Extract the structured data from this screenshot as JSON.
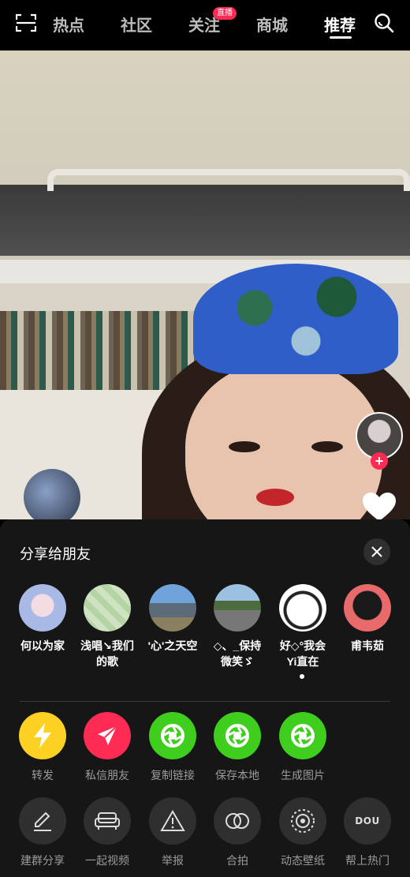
{
  "top_nav": {
    "tabs": [
      {
        "label": "热点"
      },
      {
        "label": "社区"
      },
      {
        "label": "关注"
      },
      {
        "label": "商城"
      },
      {
        "label": "推荐"
      }
    ],
    "live_badge": "直播",
    "active_tab": "推荐"
  },
  "share_sheet": {
    "title": "分享给朋友",
    "friends": [
      {
        "name": "何以为家"
      },
      {
        "name": "浅唱↘我们的歌"
      },
      {
        "name": "'心'之天空"
      },
      {
        "name": "◇、_保持微笑ゞ"
      },
      {
        "name": "好◇°我会Yi直在"
      },
      {
        "name": "甫韦茹"
      }
    ],
    "primary_actions": [
      {
        "label": "转发",
        "icon": "lightning-icon",
        "color": "#fdd124"
      },
      {
        "label": "私信朋友",
        "icon": "send-icon",
        "color": "#fe2c55"
      },
      {
        "label": "复制链接",
        "icon": "wechat-shutter-icon",
        "color": "#3fcd1e"
      },
      {
        "label": "保存本地",
        "icon": "wechat-shutter-icon",
        "color": "#3fcd1e"
      },
      {
        "label": "生成图片",
        "icon": "wechat-shutter-icon",
        "color": "#3fcd1e"
      }
    ],
    "secondary_actions": [
      {
        "label": "建群分享",
        "icon": "pencil-icon"
      },
      {
        "label": "一起视频",
        "icon": "sofa-icon"
      },
      {
        "label": "举报",
        "icon": "warning-icon"
      },
      {
        "label": "合拍",
        "icon": "duet-icon"
      },
      {
        "label": "动态壁纸",
        "icon": "wallpaper-icon"
      },
      {
        "label": "帮上热门",
        "icon": "dou-plus-icon",
        "text": "DOU"
      }
    ]
  },
  "colors": {
    "accent": "#fe2c55",
    "sheet_bg": "#161616",
    "secondary_bg": "#2f2f2f"
  }
}
